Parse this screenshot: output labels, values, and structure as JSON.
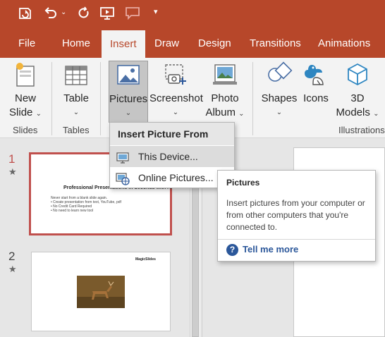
{
  "title_bar": {
    "icons": [
      "autosave-icon",
      "undo-icon",
      "redo-icon",
      "present-from-start-icon",
      "comment-icon",
      "customize-quick-access-icon"
    ]
  },
  "tabs": [
    "File",
    "Home",
    "Insert",
    "Draw",
    "Design",
    "Transitions",
    "Animations"
  ],
  "active_tab": "Insert",
  "ribbon": {
    "slides_group": {
      "label": "Slides",
      "new_slide_line1": "New",
      "new_slide_line2": "Slide"
    },
    "tables_group": {
      "label": "Tables",
      "table": "Table"
    },
    "images_group": {
      "pictures": "Pictures",
      "screenshot": "Screenshot",
      "photo_album_line1": "Photo",
      "photo_album_line2": "Album"
    },
    "illustrations_group": {
      "label": "Illustrations",
      "shapes": "Shapes",
      "icons": "Icons",
      "models_line1": "3D",
      "models_line2": "Models"
    }
  },
  "dropdown": {
    "title": "Insert Picture From",
    "items": [
      "This Device...",
      "Online Pictures..."
    ]
  },
  "tooltip": {
    "title": "Pictures",
    "body": "Insert pictures from your computer or from other computers that you're connected to.",
    "link": "Tell me more"
  },
  "slides": [
    {
      "number": "1",
      "title": "Professional Presentations in Seconds with AI",
      "lines": [
        "Never start from a blank slide again.",
        "• Create presentation from text, YouTube, pdf",
        "• No Credit Card Required",
        "• No need to learn new tool"
      ]
    },
    {
      "number": "2",
      "logo_text": "MagicSlides"
    }
  ],
  "colors": {
    "brand": "#b7472a",
    "selection": "#c0504d",
    "link": "#2b579a"
  }
}
